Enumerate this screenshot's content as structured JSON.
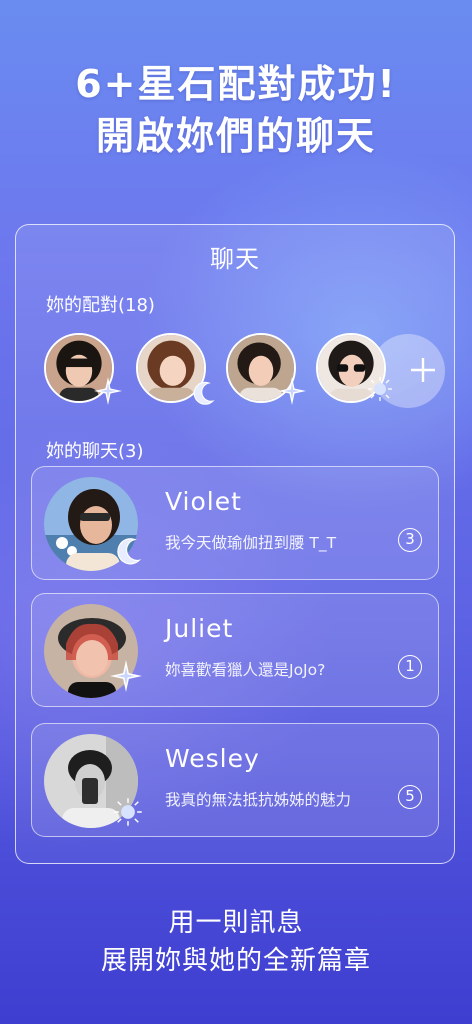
{
  "headline": {
    "line1": "6+星石配對成功!",
    "line2": "開啟妳們的聊天"
  },
  "panel": {
    "title": "聊天",
    "matches_label": "妳的配對",
    "matches_count": "(18)",
    "chats_label": "妳的聊天",
    "chats_count": "(3)"
  },
  "matches": [
    {
      "name": "match-1",
      "decoration": "sparkle-icon"
    },
    {
      "name": "match-2",
      "decoration": "moon-icon"
    },
    {
      "name": "match-3",
      "decoration": "sparkle-icon"
    },
    {
      "name": "match-4",
      "decoration": "sun-icon"
    }
  ],
  "add_button": {
    "icon": "plus-icon"
  },
  "chats": [
    {
      "name": "Violet",
      "message": "我今天做瑜伽扭到腰 T_T",
      "unread": "3",
      "decoration": "moon-icon"
    },
    {
      "name": "Juliet",
      "message": "妳喜歡看獵人還是JoJo?",
      "unread": "1",
      "decoration": "sparkle-icon"
    },
    {
      "name": "Wesley",
      "message": "我真的無法抵抗姊姊的魅力",
      "unread": "5",
      "decoration": "sun-icon"
    }
  ],
  "footer": {
    "line1": "用一則訊息",
    "line2": "展開妳與她的全新篇章"
  },
  "colors": {
    "bg_top": "#6a8cf0",
    "bg_bottom": "#3e3ed0",
    "text": "#ffffff"
  }
}
